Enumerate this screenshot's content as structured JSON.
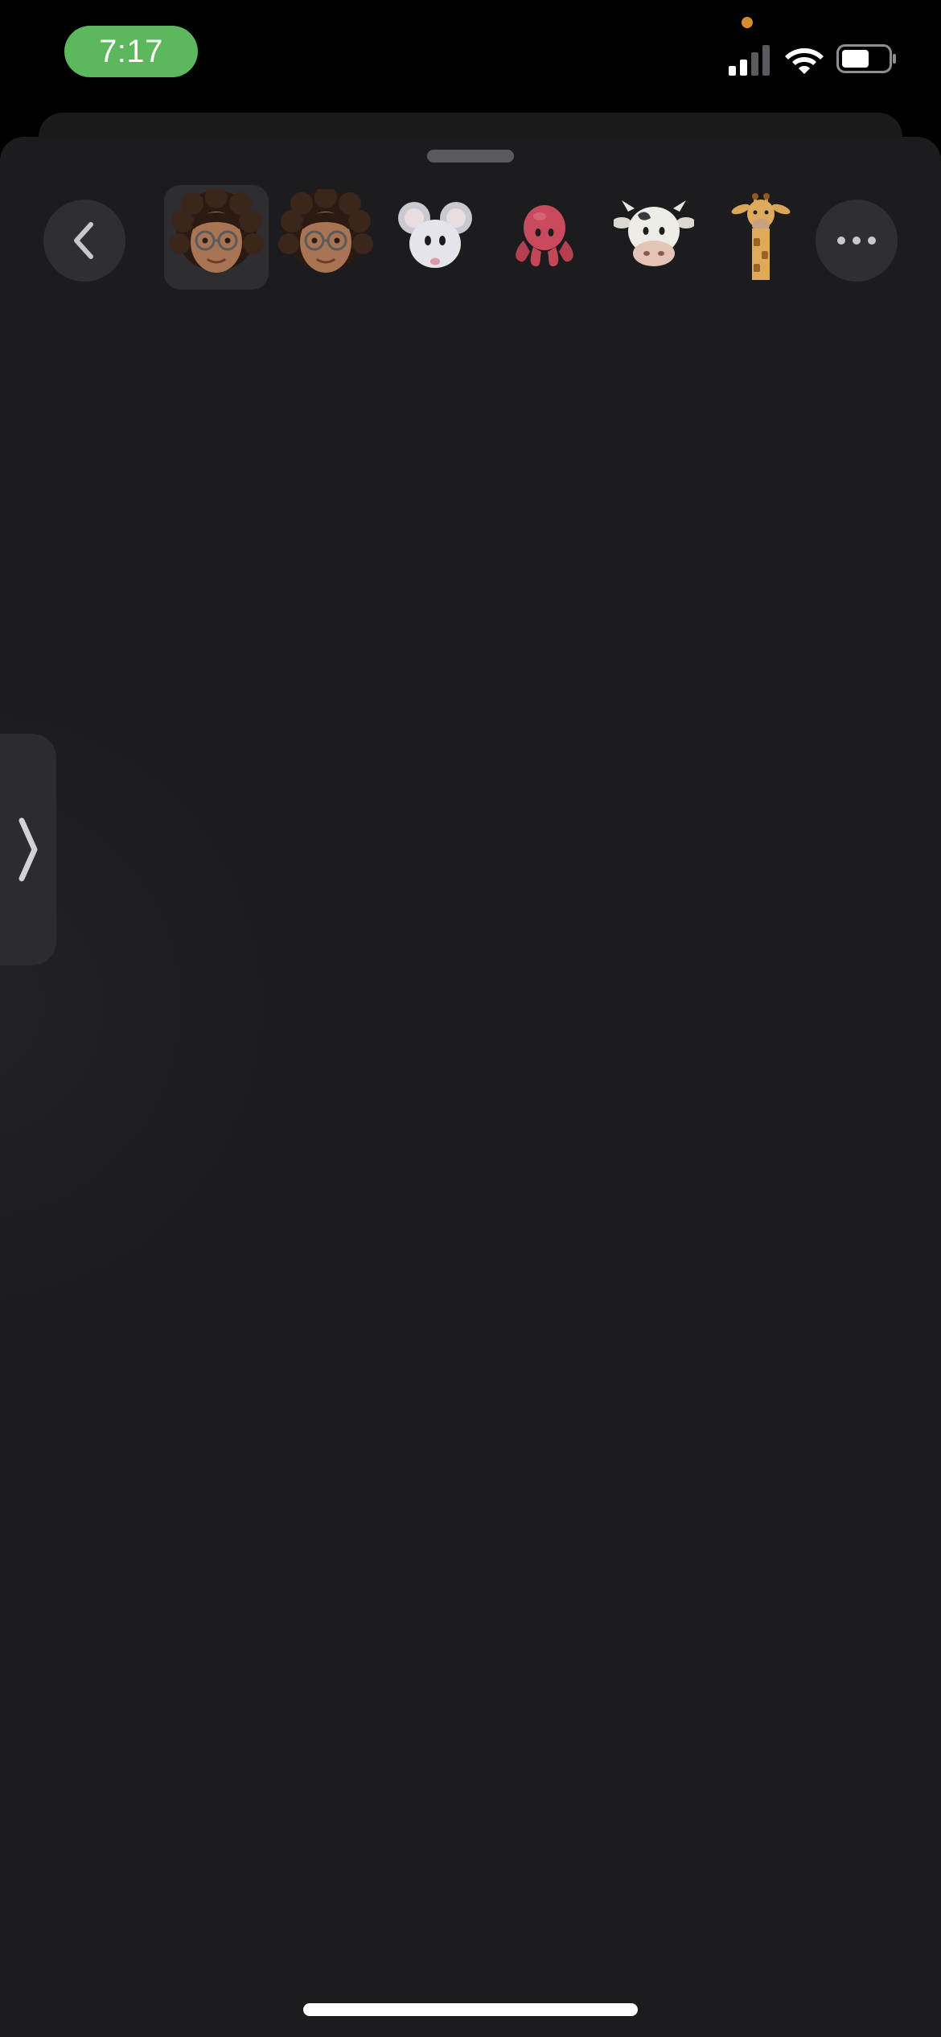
{
  "status_bar": {
    "time": "7:17",
    "time_pill_color": "#5cb85c",
    "privacy_dot_color": "#d98a2b",
    "icons": [
      "signal-icon",
      "wifi-icon",
      "battery-icon"
    ],
    "battery_level": 0.6,
    "signal_bars_active": 2
  },
  "sticker_picker": {
    "back_icon": "chevron-left-icon",
    "more_icon": "ellipsis-icon",
    "avatars": [
      {
        "name": "memoji-curly-hair-glasses",
        "selected": true
      },
      {
        "name": "memoji-curly-hair-glasses",
        "selected": false
      },
      {
        "name": "mouse",
        "selected": false
      },
      {
        "name": "octopus",
        "selected": false
      },
      {
        "name": "cow",
        "selected": false
      },
      {
        "name": "giraffe",
        "selected": false
      }
    ]
  },
  "side_handle": {
    "icon": "chevron-right-icon"
  },
  "colors": {
    "sheet_background": "#1c1c1e",
    "button_background": "#2f2f33"
  }
}
